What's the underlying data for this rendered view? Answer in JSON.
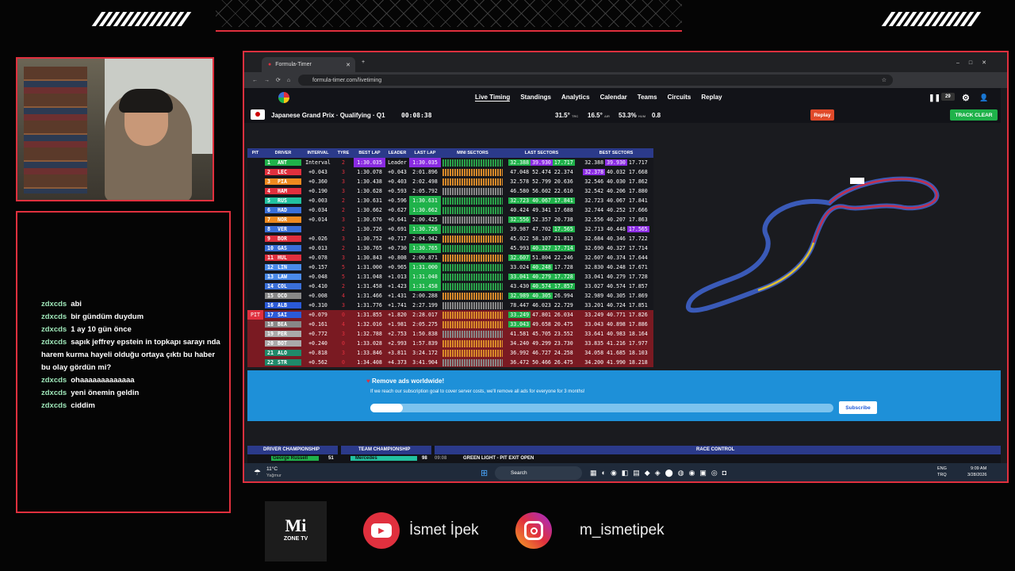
{
  "chat": [
    {
      "user": "zdxcds",
      "msg": "abi"
    },
    {
      "user": "zdxcds",
      "msg": "bir gündüm duydum"
    },
    {
      "user": "zdxcds",
      "msg": "1 ay 10 gün önce"
    },
    {
      "user": "zdxcds",
      "msg": "sapık jeffrey epstein in topkapı sarayı nda harem kurma hayeli olduğu ortaya çıktı bu haber bu olay gördün mi?"
    },
    {
      "user": "zdxcds",
      "msg": "ohaaaaaaaaaaaaa"
    },
    {
      "user": "zdxcds",
      "msg": "yeni önemin geldin"
    },
    {
      "user": "zdxcds",
      "msg": "ciddim"
    }
  ],
  "browser": {
    "tab_title": "Formula-Timer",
    "url": "formula-timer.com/livetiming"
  },
  "nav": {
    "items": [
      "Live Timing",
      "Standings",
      "Analytics",
      "Calendar",
      "Teams",
      "Circuits",
      "Replay"
    ],
    "counter": "29"
  },
  "session": {
    "title": "Japanese Grand Prix · Qualifying · Q1",
    "clock": "00:08:38",
    "track_temp": "31.5°",
    "track_label": "TRC",
    "air_temp": "16.5°",
    "air_label": "AIR",
    "humidity": "53.3%",
    "hum_label": "HUM",
    "wind": "0.8",
    "replay_btn": "Replay",
    "track_clear_btn": "TRACK CLEAR"
  },
  "table": {
    "headers": [
      "PIT",
      "DRIVER",
      "INTERVAL",
      "TYRE",
      "BEST LAP",
      "LEADER",
      "LAST LAP",
      "MINI SECTORS",
      "LAST SECTORS",
      "BEST SECTORS"
    ],
    "rows": [
      {
        "p": "1",
        "d": "ANT",
        "i": "Interval",
        "t": "2",
        "b": "1:30.035",
        "l": "Leader",
        "ll": "1:30.035",
        "s1": "32.388",
        "s2": "39.930",
        "s3": "17.717",
        "b1": "32.388",
        "b2": "39.930",
        "b3": "17.717",
        "c": "#1fb24a",
        "pit": ""
      },
      {
        "p": "2",
        "d": "LEC",
        "i": "+0.043",
        "t": "3",
        "b": "1:30.078",
        "l": "+0.043",
        "ll": "2:01.896",
        "s1": "47.048",
        "s2": "52.474",
        "s3": "22.374",
        "b1": "32.378",
        "b2": "40.032",
        "b3": "17.668",
        "c": "#e0303e",
        "pit": ""
      },
      {
        "p": "3",
        "d": "PIA",
        "i": "+0.360",
        "t": "3",
        "b": "1:30.438",
        "l": "+0.403",
        "ll": "2:02.498",
        "s1": "32.578",
        "s2": "52.799",
        "s3": "20.636",
        "b1": "32.546",
        "b2": "40.030",
        "b3": "17.862",
        "c": "#ef8a1f",
        "pit": ""
      },
      {
        "p": "4",
        "d": "HAM",
        "i": "+0.190",
        "t": "3",
        "b": "1:30.628",
        "l": "+0.593",
        "ll": "2:05.792",
        "s1": "46.580",
        "s2": "56.602",
        "s3": "22.610",
        "b1": "32.542",
        "b2": "40.206",
        "b3": "17.880",
        "c": "#e0303e",
        "pit": ""
      },
      {
        "p": "5",
        "d": "RUS",
        "i": "+0.003",
        "t": "2",
        "b": "1:30.631",
        "l": "+0.596",
        "ll": "1:30.631",
        "s1": "32.723",
        "s2": "40.067",
        "s3": "17.841",
        "b1": "32.723",
        "b2": "40.067",
        "b3": "17.841",
        "c": "#22c1a0",
        "pit": ""
      },
      {
        "p": "6",
        "d": "HAD",
        "i": "+0.034",
        "t": "2",
        "b": "1:30.662",
        "l": "+0.627",
        "ll": "1:30.662",
        "s1": "40.424",
        "s2": "49.341",
        "s3": "17.688",
        "b1": "32.744",
        "b2": "40.252",
        "b3": "17.666",
        "c": "#3a6fd8",
        "pit": ""
      },
      {
        "p": "7",
        "d": "NOR",
        "i": "+0.014",
        "t": "3",
        "b": "1:30.676",
        "l": "+0.641",
        "ll": "2:00.425",
        "s1": "32.556",
        "s2": "52.357",
        "s3": "20.738",
        "b1": "32.556",
        "b2": "40.207",
        "b3": "17.863",
        "c": "#ef8a1f",
        "pit": ""
      },
      {
        "p": "8",
        "d": "VER",
        "i": "",
        "t": "2",
        "b": "1:30.726",
        "l": "+0.691",
        "ll": "1:30.726",
        "s1": "39.987",
        "s2": "47.702",
        "s3": "17.565",
        "b1": "32.713",
        "b2": "40.448",
        "b3": "17.565",
        "c": "#3a6fd8",
        "pit": ""
      },
      {
        "p": "9",
        "d": "BOR",
        "i": "+0.026",
        "t": "3",
        "b": "1:30.752",
        "l": "+0.717",
        "ll": "2:04.942",
        "s1": "45.022",
        "s2": "58.107",
        "s3": "21.813",
        "b1": "32.684",
        "b2": "40.346",
        "b3": "17.722",
        "c": "#e0303e",
        "pit": ""
      },
      {
        "p": "10",
        "d": "GAS",
        "i": "+0.013",
        "t": "2",
        "b": "1:30.765",
        "l": "+0.730",
        "ll": "1:30.765",
        "s1": "45.993",
        "s2": "40.327",
        "s3": "17.714",
        "b1": "32.690",
        "b2": "40.327",
        "b3": "17.714",
        "c": "#3a6fd8",
        "pit": ""
      },
      {
        "p": "11",
        "d": "HUL",
        "i": "+0.078",
        "t": "3",
        "b": "1:30.843",
        "l": "+0.808",
        "ll": "2:00.871",
        "s1": "32.607",
        "s2": "51.804",
        "s3": "22.246",
        "b1": "32.607",
        "b2": "40.374",
        "b3": "17.644",
        "c": "#e0303e",
        "pit": ""
      },
      {
        "p": "12",
        "d": "LIN",
        "i": "+0.157",
        "t": "5",
        "b": "1:31.000",
        "l": "+0.965",
        "ll": "1:31.000",
        "s1": "33.024",
        "s2": "40.248",
        "s3": "17.728",
        "b1": "32.830",
        "b2": "40.248",
        "b3": "17.671",
        "c": "#4a8ae8",
        "pit": ""
      },
      {
        "p": "13",
        "d": "LAW",
        "i": "+0.048",
        "t": "5",
        "b": "1:31.048",
        "l": "+1.013",
        "ll": "1:31.048",
        "s1": "33.041",
        "s2": "40.279",
        "s3": "17.728",
        "b1": "33.041",
        "b2": "40.279",
        "b3": "17.728",
        "c": "#4a8ae8",
        "pit": ""
      },
      {
        "p": "14",
        "d": "COL",
        "i": "+0.410",
        "t": "2",
        "b": "1:31.458",
        "l": "+1.423",
        "ll": "1:31.458",
        "s1": "43.430",
        "s2": "40.574",
        "s3": "17.857",
        "b1": "33.027",
        "b2": "40.574",
        "b3": "17.857",
        "c": "#3a6fd8",
        "pit": ""
      },
      {
        "p": "15",
        "d": "OCO",
        "i": "+0.008",
        "t": "4",
        "b": "1:31.466",
        "l": "+1.431",
        "ll": "2:00.288",
        "s1": "32.989",
        "s2": "40.305",
        "s3": "26.994",
        "b1": "32.989",
        "b2": "40.305",
        "b3": "17.869",
        "c": "#888888",
        "pit": ""
      },
      {
        "p": "16",
        "d": "ALB",
        "i": "+0.310",
        "t": "3",
        "b": "1:31.776",
        "l": "+1.741",
        "ll": "2:27.199",
        "s1": "78.447",
        "s2": "46.023",
        "s3": "22.729",
        "b1": "33.201",
        "b2": "40.724",
        "b3": "17.851",
        "c": "#2a5ad8",
        "pit": ""
      },
      {
        "p": "17",
        "d": "SAI",
        "i": "+0.079",
        "t": "0",
        "b": "1:31.855",
        "l": "+1.820",
        "ll": "2:28.017",
        "s1": "33.249",
        "s2": "47.801",
        "s3": "26.034",
        "b1": "33.249",
        "b2": "40.771",
        "b3": "17.826",
        "c": "#2a5ad8",
        "pit": "PIT"
      },
      {
        "p": "18",
        "d": "BEA",
        "i": "+0.161",
        "t": "4",
        "b": "1:32.016",
        "l": "+1.981",
        "ll": "2:05.275",
        "s1": "33.043",
        "s2": "49.658",
        "s3": "20.475",
        "b1": "33.043",
        "b2": "40.898",
        "b3": "17.886",
        "c": "#888888",
        "pit": ""
      },
      {
        "p": "19",
        "d": "PER",
        "i": "+0.772",
        "t": "3",
        "b": "1:32.788",
        "l": "+2.753",
        "ll": "1:50.838",
        "s1": "41.581",
        "s2": "45.705",
        "s3": "23.552",
        "b1": "33.641",
        "b2": "40.983",
        "b3": "18.164",
        "c": "#aaaaaa",
        "pit": ""
      },
      {
        "p": "20",
        "d": "BOT",
        "i": "+0.240",
        "t": "0",
        "b": "1:33.028",
        "l": "+2.993",
        "ll": "1:57.839",
        "s1": "34.240",
        "s2": "49.299",
        "s3": "23.730",
        "b1": "33.835",
        "b2": "41.216",
        "b3": "17.977",
        "c": "#aaaaaa",
        "pit": ""
      },
      {
        "p": "21",
        "d": "ALO",
        "i": "+0.818",
        "t": "3",
        "b": "1:33.846",
        "l": "+3.811",
        "ll": "3:24.172",
        "s1": "36.992",
        "s2": "46.727",
        "s3": "24.258",
        "b1": "34.058",
        "b2": "41.685",
        "b3": "18.103",
        "c": "#1f8a6a",
        "pit": ""
      },
      {
        "p": "22",
        "d": "STR",
        "i": "+0.562",
        "t": "0",
        "b": "1:34.408",
        "l": "+4.373",
        "ll": "3:41.904",
        "s1": "36.472",
        "s2": "50.466",
        "s3": "26.475",
        "b1": "34.200",
        "b2": "41.990",
        "b3": "18.218",
        "c": "#1f8a6a",
        "pit": ""
      }
    ]
  },
  "ad": {
    "title": "Remove ads worldwide!",
    "text": "If we reach our subscription goal to cover server costs, we'll remove all ads for everyone for 3 months!",
    "button": "Subscribe",
    "progress": 0.07
  },
  "bottom": {
    "driver_ch": "DRIVER CHAMPIONSHIP",
    "team_ch": "TEAM CHAMPIONSHIP",
    "race_control": "RACE CONTROL",
    "driver_row": "George Russell",
    "driver_pts": "51",
    "team_row": "Mercedes",
    "team_pts": "98",
    "rc_time": "09:08",
    "rc_msg": "GREEN LIGHT - PIT EXIT OPEN"
  },
  "taskbar": {
    "weather_temp": "11°C",
    "weather_text": "Yağmur",
    "search": "Search",
    "lang1": "ENG",
    "lang2": "TRQ",
    "time": "9:09 AM",
    "date": "3/28/2026"
  },
  "branding": {
    "logo_main": "Mi",
    "logo_sub": "ZONE TV",
    "youtube": "İsmet İpek",
    "instagram": "m_ismetipek"
  }
}
